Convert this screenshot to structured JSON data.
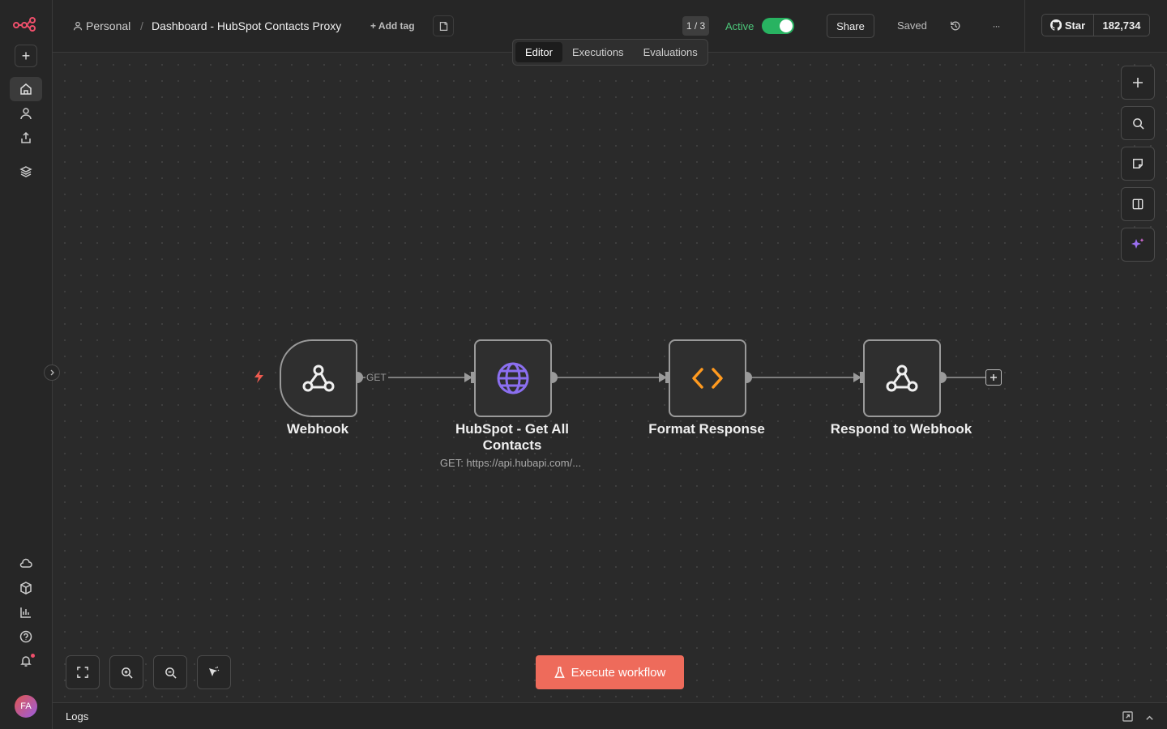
{
  "header": {
    "project": "Personal",
    "separator": "/",
    "workflow_name": "Dashboard - HubSpot Contacts Proxy",
    "add_tag": "+ Add tag",
    "version": "1 / 3",
    "active_label": "Active",
    "active": true,
    "share": "Share",
    "saved": "Saved",
    "more": "···",
    "github_star": "Star",
    "github_count": "182,734"
  },
  "tabs": [
    "Editor",
    "Executions",
    "Evaluations"
  ],
  "nodes": [
    {
      "label": "Webhook",
      "icon": "webhook-icon"
    },
    {
      "label": "HubSpot - Get All Contacts",
      "subtitle": "GET: https://api.hubapi.com/...",
      "icon": "globe-icon"
    },
    {
      "label": "Format Response",
      "icon": "code-icon"
    },
    {
      "label": "Respond to Webhook",
      "icon": "webhook-icon"
    }
  ],
  "connection_label": "GET",
  "execute_button": "Execute workflow",
  "logs_label": "Logs",
  "avatar_initials": "FA",
  "colors": {
    "accent": "#ee6b5b",
    "active_green": "#28b361",
    "globe": "#8b6ff0",
    "code": "#ff9a1f"
  }
}
